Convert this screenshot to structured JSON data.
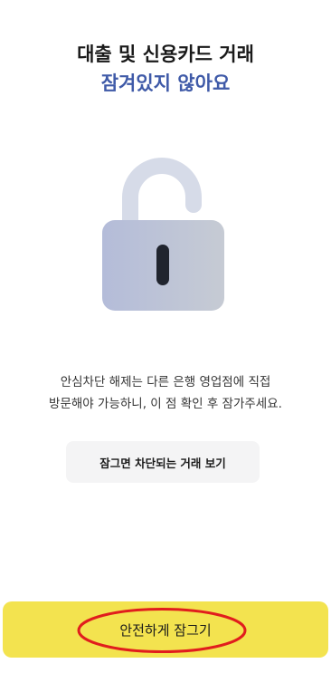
{
  "header": {
    "title_line1": "대출 및 신용카드 거래",
    "title_line2": "잠겨있지 않아요",
    "title_line2_color": "#3f5aa8"
  },
  "illustration": {
    "icon": "unlocked-padlock-icon"
  },
  "description": {
    "line1": "안심차단 해제는 다른 은행 영업점에 직접",
    "line2": "방문해야 가능하니, 이 점 확인 후 잠가주세요."
  },
  "view_blocked_button": {
    "label": "잠그면 차단되는 거래 보기"
  },
  "primary_button": {
    "label": "안전하게 잠그기",
    "color": "#f3e34f"
  },
  "annotation": {
    "highlight_color": "#e11d1d"
  }
}
